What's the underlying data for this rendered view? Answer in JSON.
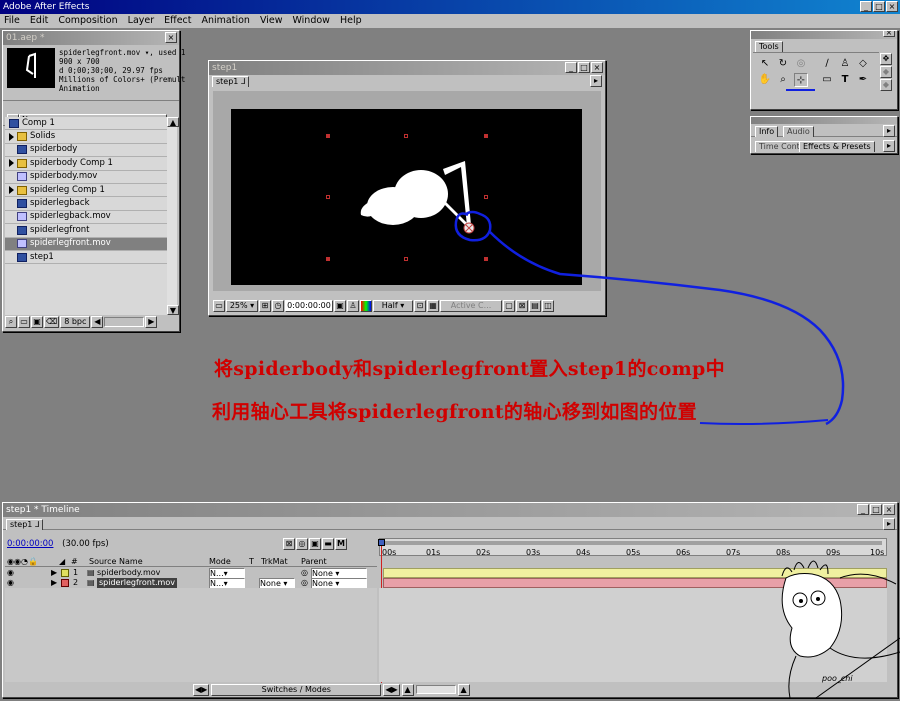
{
  "app": {
    "title": "Adobe After Effects"
  },
  "menu": [
    "File",
    "Edit",
    "Composition",
    "Layer",
    "Effect",
    "Animation",
    "View",
    "Window",
    "Help"
  ],
  "project": {
    "title": "01.aep *",
    "info_name": "spiderlegfront.mov ▾, used 1",
    "info_line2": "900 x 700",
    "info_line3": "d 0;00;30;00, 29.97 fps",
    "info_line4": "Millions of Colors+ (Premult",
    "info_line5": "Animation",
    "column_name": "Name",
    "items": [
      {
        "label": "Comp 1",
        "icon": "comp-icon",
        "folder": false
      },
      {
        "label": "Solids",
        "icon": "folder-icon",
        "folder": true
      },
      {
        "label": "spiderbody",
        "icon": "comp-icon",
        "folder": false
      },
      {
        "label": "spiderbody Comp 1",
        "icon": "folder-icon",
        "folder": true
      },
      {
        "label": "spiderbody.mov",
        "icon": "file-icon",
        "folder": false
      },
      {
        "label": "spiderleg Comp 1",
        "icon": "folder-icon",
        "folder": true
      },
      {
        "label": "spiderlegback",
        "icon": "comp-icon",
        "folder": false
      },
      {
        "label": "spiderlegback.mov",
        "icon": "file-icon",
        "folder": false
      },
      {
        "label": "spiderlegfront",
        "icon": "comp-icon",
        "folder": false
      },
      {
        "label": "spiderlegfront.mov",
        "icon": "file-icon",
        "folder": false,
        "selected": true
      },
      {
        "label": "step1",
        "icon": "comp-icon",
        "folder": false
      }
    ],
    "bpc": "8 bpc"
  },
  "viewer": {
    "title": "step1",
    "tab": "step1",
    "zoom": "25%",
    "timecode": "0:00:00:00",
    "resolution": "Half",
    "camera": "Active C..."
  },
  "tools": {
    "title": "Tools"
  },
  "info_panel": {
    "tabs": [
      "Info",
      "Audio"
    ],
    "tabs2": [
      "Time Contr",
      "Effects & Presets"
    ]
  },
  "overlay": {
    "line1": "将spiderbody和spiderlegfront置入step1的comp中",
    "line2": "利用轴心工具将spiderlegfront的轴心移到如图的位置"
  },
  "timeline": {
    "title": "step1 * Timeline",
    "tab": "step1",
    "timecode": "0:00:00:00",
    "fps": "(30.00 fps)",
    "columns": {
      "num": "#",
      "source": "Source Name",
      "mode": "Mode",
      "t": "T",
      "trkmat": "TrkMat",
      "parent": "Parent"
    },
    "layers": [
      {
        "num": "1",
        "name": "spiderbody.mov",
        "mode": "N...",
        "trkmat": "",
        "parent": "None",
        "color": "#e0e060"
      },
      {
        "num": "2",
        "name": "spiderlegfront.mov",
        "mode": "N...",
        "trkmat": "None",
        "parent": "None",
        "color": "#e06060",
        "selected": true
      }
    ],
    "ticks": [
      "00s",
      "01s",
      "02s",
      "03s",
      "04s",
      "05s",
      "06s",
      "07s",
      "08s",
      "09s",
      "10s"
    ],
    "footer": "Switches / Modes"
  },
  "cartoon": {
    "signature": "poo_chi"
  }
}
